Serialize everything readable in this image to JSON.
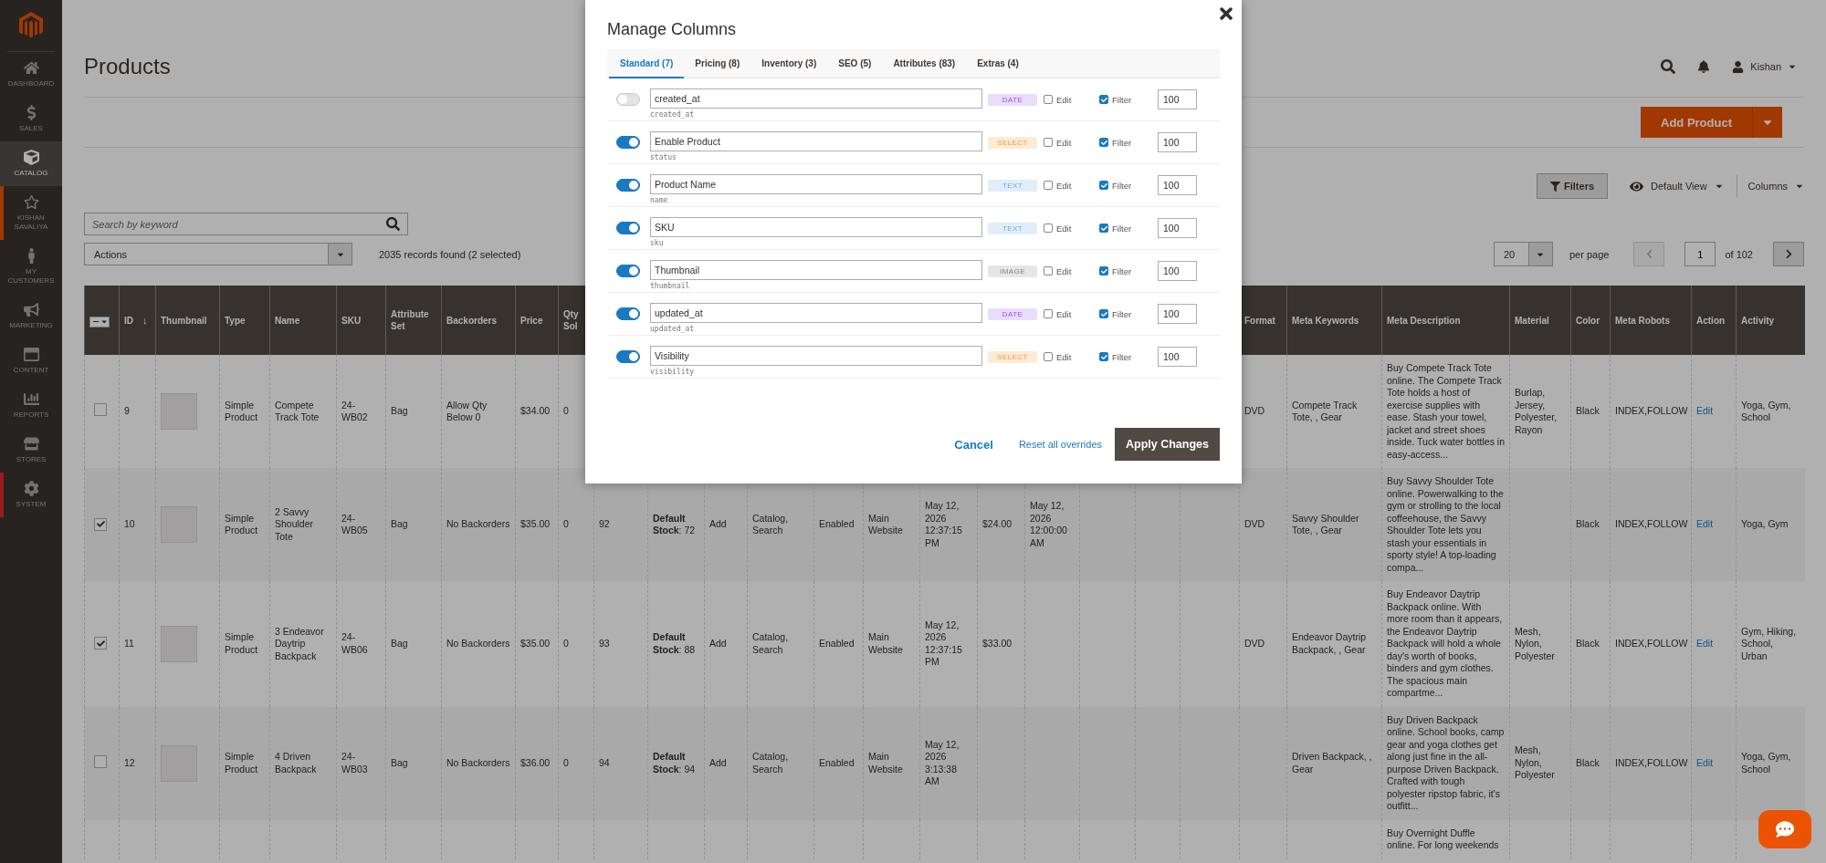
{
  "sidebar": {
    "items": [
      {
        "label": "DASHBOARD",
        "selected": false
      },
      {
        "label": "SALES",
        "selected": false
      },
      {
        "label": "CATALOG",
        "selected": true
      },
      {
        "label": "KISHAN SAVALIYA",
        "selected": false,
        "color": "#a23901"
      },
      {
        "label": "MY CUSTOMERS",
        "selected": false
      },
      {
        "label": "MARKETING",
        "selected": false
      },
      {
        "label": "CONTENT",
        "selected": false
      },
      {
        "label": "REPORTS",
        "selected": false
      },
      {
        "label": "STORES",
        "selected": false
      },
      {
        "label": "SYSTEM",
        "selected": false,
        "color": "#9c1a1a"
      }
    ]
  },
  "header": {
    "title": "Products",
    "user": "Kishan"
  },
  "primary_action": {
    "label": "Add Product"
  },
  "grid_toolbar": {
    "filters": "Filters",
    "view": "Default View",
    "columns": "Columns"
  },
  "search": {
    "placeholder": "Search by keyword"
  },
  "mass_actions": {
    "value": "Actions"
  },
  "records": "2035 records found (2 selected)",
  "pager": {
    "per_page": "20",
    "per_page_label": "per page",
    "page": "1",
    "total": "of 102",
    "prev_disabled": true
  },
  "table": {
    "columns": [
      {
        "label": "ID",
        "kind": "text",
        "sort_arrow": "↓"
      },
      {
        "label": "Thumbnail",
        "kind": "thumbnail"
      },
      {
        "label": "Type",
        "kind": "text"
      },
      {
        "label": "Name",
        "kind": "text"
      },
      {
        "label": "SKU",
        "kind": "text"
      },
      {
        "label": "Attribute Set",
        "kind": "text"
      },
      {
        "label": "Backorders",
        "kind": "text"
      },
      {
        "label": "Price",
        "kind": "text"
      },
      {
        "label": "Qty Sol",
        "kind": "text"
      },
      {
        "kind": "text"
      },
      {
        "kind": "text"
      },
      {
        "kind": "text"
      },
      {
        "kind": "text"
      },
      {
        "kind": "text"
      },
      {
        "kind": "text"
      },
      {
        "kind": "text"
      },
      {
        "kind": "text"
      },
      {
        "kind": "text"
      },
      {
        "kind": "text"
      },
      {
        "kind": "text"
      },
      {
        "kind": "text"
      },
      {
        "label": "Format",
        "kind": "text"
      },
      {
        "label": "Meta Keywords",
        "kind": "text"
      },
      {
        "label": "Meta Description",
        "kind": "text"
      },
      {
        "label": "Material",
        "kind": "text"
      },
      {
        "label": "Color",
        "kind": "text"
      },
      {
        "label": "Meta Robots",
        "kind": "text"
      },
      {
        "label": "Action",
        "kind": "link"
      },
      {
        "label": "Activity",
        "kind": "text"
      }
    ],
    "rows": [
      {
        "selected": false,
        "cells": [
          "9",
          "",
          "Simple Product",
          "Compete Track Tote",
          "24-WB02",
          "Bag",
          "Allow Qty Below 0",
          "$34.00",
          "0",
          "",
          "",
          "",
          "",
          "",
          "",
          "",
          "",
          "",
          "",
          "",
          "",
          "DVD",
          "Compete Track Tote, , Gear",
          "Buy Compete Track Tote online. The Compete Track Tote holds a host of exercise supplies with ease. Stash your towel, jacket and street shoes inside. Tuck water bottles in easy-access...",
          "Burlap, Jersey, Polyester, Rayon",
          "Black",
          "INDEX,FOLLOW",
          "Edit",
          "Yoga, Gym, School"
        ]
      },
      {
        "selected": true,
        "cells": [
          "10",
          "",
          "Simple Product",
          "2 Savvy Shoulder Tote",
          "24-WB05",
          "Bag",
          "No Backorders",
          "$35.00",
          "0",
          "92",
          "**Default Stock**: 72",
          "Add",
          "Catalog, Search",
          "Enabled",
          "Main Website",
          "May 12, 2026 12:37:15 PM",
          "$24.00",
          "May 12, 2026 12:00:00 AM",
          "",
          "",
          "",
          "DVD",
          "Savvy Shoulder Tote, , Gear",
          "Buy Savvy Shoulder Tote online. Powerwalking to the gym or strolling to the local coffeehouse, the Savvy Shoulder Tote lets you stash your essentials in sporty style! A top-loading compa...",
          "",
          "Black",
          "INDEX,FOLLOW",
          "Edit",
          "Yoga, Gym"
        ]
      },
      {
        "selected": true,
        "cells": [
          "11",
          "",
          "Simple Product",
          "3 Endeavor Daytrip Backpack",
          "24-WB06",
          "Bag",
          "No Backorders",
          "$35.00",
          "0",
          "93",
          "**Default Stock**: 88",
          "Add",
          "Catalog, Search",
          "Enabled",
          "Main Website",
          "May 12, 2026 12:37:15 PM",
          "$33.00",
          "",
          "",
          "",
          "",
          "DVD",
          "Endeavor Daytrip Backpack, , Gear",
          "Buy Endeavor Daytrip Backpack online. With more room than it appears, the Endeavor Daytrip Backpack will hold a whole day's worth of books, binders and gym clothes. The spacious main compartme...",
          "Mesh, Nylon, Polyester",
          "Black",
          "INDEX,FOLLOW",
          "Edit",
          "Gym, Hiking, School, Urban"
        ]
      },
      {
        "selected": false,
        "cells": [
          "12",
          "",
          "Simple Product",
          "4 Driven Backpack",
          "24-WB03",
          "Bag",
          "No Backorders",
          "$36.00",
          "0",
          "94",
          "**Default Stock**: 94",
          "Add",
          "Catalog, Search",
          "Enabled",
          "Main Website",
          "May 12, 2026 3:13:38 AM",
          "",
          "",
          "",
          "",
          "",
          "",
          "Driven Backpack, , Gear",
          "Buy Driven Backpack online. School books, camp gear and yoga clothes get along just fine in the all-purpose Driven Backpack. Crafted with tough polyester ripstop fabric, it's outfitt...",
          "Mesh, Nylon, Polyester",
          "Black",
          "INDEX,FOLLOW",
          "Edit",
          "Yoga, Gym, School"
        ]
      },
      {
        "cells": [
          "",
          "",
          "",
          "",
          "",
          "",
          "",
          "",
          "",
          "",
          "",
          "",
          "",
          "",
          "",
          "",
          "",
          "",
          "",
          "",
          "",
          "",
          "",
          "Buy Overnight Duffle online. For long weekends",
          "",
          "",
          "",
          "",
          ""
        ]
      }
    ]
  },
  "modal": {
    "title": "Manage Columns",
    "tabs": [
      {
        "label": "Standard (7)",
        "selected": true
      },
      {
        "label": "Pricing (8)",
        "selected": false
      },
      {
        "label": "Inventory (3)",
        "selected": false
      },
      {
        "label": "SEO (5)",
        "selected": false
      },
      {
        "label": "Attributes (83)",
        "selected": false
      },
      {
        "label": "Extras (4)",
        "selected": false
      }
    ],
    "rows": [
      {
        "on": false,
        "label": "created_at",
        "code": "created_at",
        "type": "DATE",
        "color": "#eadcfd",
        "edit": {
          "label": "Edit",
          "checked": false
        },
        "filter": {
          "label": "Filter",
          "checked": true
        },
        "number": "100"
      },
      {
        "on": true,
        "label": "Enable Product",
        "code": "status",
        "type": "SELECT",
        "color": "#fdebd6",
        "edit": {
          "label": "Edit",
          "checked": false
        },
        "filter": {
          "label": "Filter",
          "checked": true
        },
        "number": "100"
      },
      {
        "on": true,
        "label": "Product Name",
        "code": "name",
        "type": "TEXT",
        "color": "#e1eefa",
        "edit": {
          "label": "Edit",
          "checked": false
        },
        "filter": {
          "label": "Filter",
          "checked": true
        },
        "number": "100"
      },
      {
        "on": true,
        "label": "SKU",
        "code": "sku",
        "type": "TEXT",
        "color": "#e1eefa",
        "edit": {
          "label": "Edit",
          "checked": false
        },
        "filter": {
          "label": "Filter",
          "checked": true
        },
        "number": "100"
      },
      {
        "on": true,
        "label": "Thumbnail",
        "code": "thumbnail",
        "type": "IMAGE",
        "color": "#e6e6e6",
        "edit": {
          "label": "Edit",
          "checked": false
        },
        "filter": {
          "label": "Filter",
          "checked": true
        },
        "number": "100"
      },
      {
        "on": true,
        "label": "updated_at",
        "code": "updated_at",
        "type": "DATE",
        "color": "#eadcfd",
        "edit": {
          "label": "Edit",
          "checked": false
        },
        "filter": {
          "label": "Filter",
          "checked": true
        },
        "number": "100"
      },
      {
        "on": true,
        "label": "Visibility",
        "code": "visibility",
        "type": "SELECT",
        "color": "#fdebd6",
        "edit": {
          "label": "Edit",
          "checked": false
        },
        "filter": {
          "label": "Filter",
          "checked": true
        },
        "number": "100"
      }
    ],
    "buttons": {
      "cancel": "Cancel",
      "reset": "Reset all overrides",
      "apply": "Apply Changes"
    }
  }
}
